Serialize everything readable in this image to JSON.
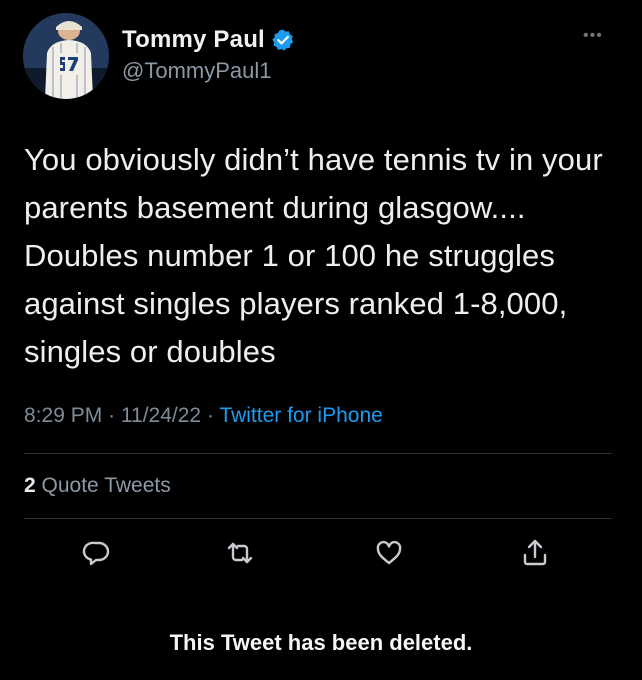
{
  "tweet": {
    "author": {
      "name": "Tommy Paul",
      "handle": "@TommyPaul1",
      "verified": true,
      "avatar_icon": "user-avatar"
    },
    "text": "You obviously didn’t have tennis tv in your parents basement during glasgow.... Doubles number 1 or 100 he struggles against singles players ranked 1-8,000, singles or doubles",
    "time": "8:29 PM",
    "separator": "·",
    "date": "11/24/22",
    "source": "Twitter for iPhone",
    "quote_tweets": {
      "count": "2",
      "label": "Quote Tweets"
    },
    "actions": [
      "reply-icon",
      "retweet-icon",
      "like-icon",
      "share-icon"
    ],
    "deleted_notice": "This Tweet has been deleted."
  },
  "colors": {
    "background": "#000000",
    "text": "#e7e9ea",
    "secondary": "#8b98a5",
    "accent": "#1d9bf0",
    "divider": "#2f3336"
  }
}
